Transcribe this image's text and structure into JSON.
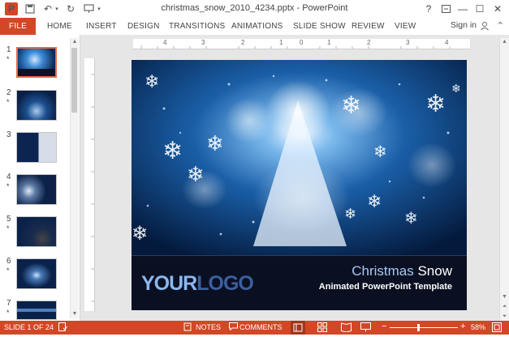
{
  "title_bar": {
    "app_icon_letter": "P",
    "document_title": "christmas_snow_2010_4234.pptx - PowerPoint",
    "help": "?",
    "minimize": "—",
    "maximize": "☐",
    "close": "✕"
  },
  "ribbon": {
    "file_tab": "FILE",
    "tabs": [
      "HOME",
      "INSERT",
      "DESIGN",
      "TRANSITIONS",
      "ANIMATIONS",
      "SLIDE SHOW",
      "REVIEW",
      "VIEW"
    ],
    "sign_in": "Sign in"
  },
  "thumbnails": [
    {
      "number": "1",
      "star": "*",
      "selected": true
    },
    {
      "number": "2",
      "star": "*",
      "selected": false
    },
    {
      "number": "3",
      "star": "",
      "selected": false
    },
    {
      "number": "4",
      "star": "*",
      "selected": false
    },
    {
      "number": "5",
      "star": "*",
      "selected": false
    },
    {
      "number": "6",
      "star": "*",
      "selected": false
    },
    {
      "number": "7",
      "star": "*",
      "selected": false
    }
  ],
  "ruler": {
    "labels": [
      "4",
      "3",
      "2",
      "1",
      "0",
      "1",
      "2",
      "3",
      "4"
    ]
  },
  "slide": {
    "title_part1": "Christmas",
    "title_part2": "Snow",
    "subtitle": "Animated PowerPoint Template",
    "logo_part1": "YOUR",
    "logo_part2": "LOGO"
  },
  "status_bar": {
    "slide_info": "SLIDE 1 OF 24",
    "notes": "NOTES",
    "comments": "COMMENTS",
    "zoom_out": "−",
    "zoom_in": "+",
    "zoom_percent": "58%",
    "zoom_level": 58
  },
  "colors": {
    "accent": "#d24726",
    "slide_background": "#06224a",
    "title_light": "#a8c8f2"
  }
}
